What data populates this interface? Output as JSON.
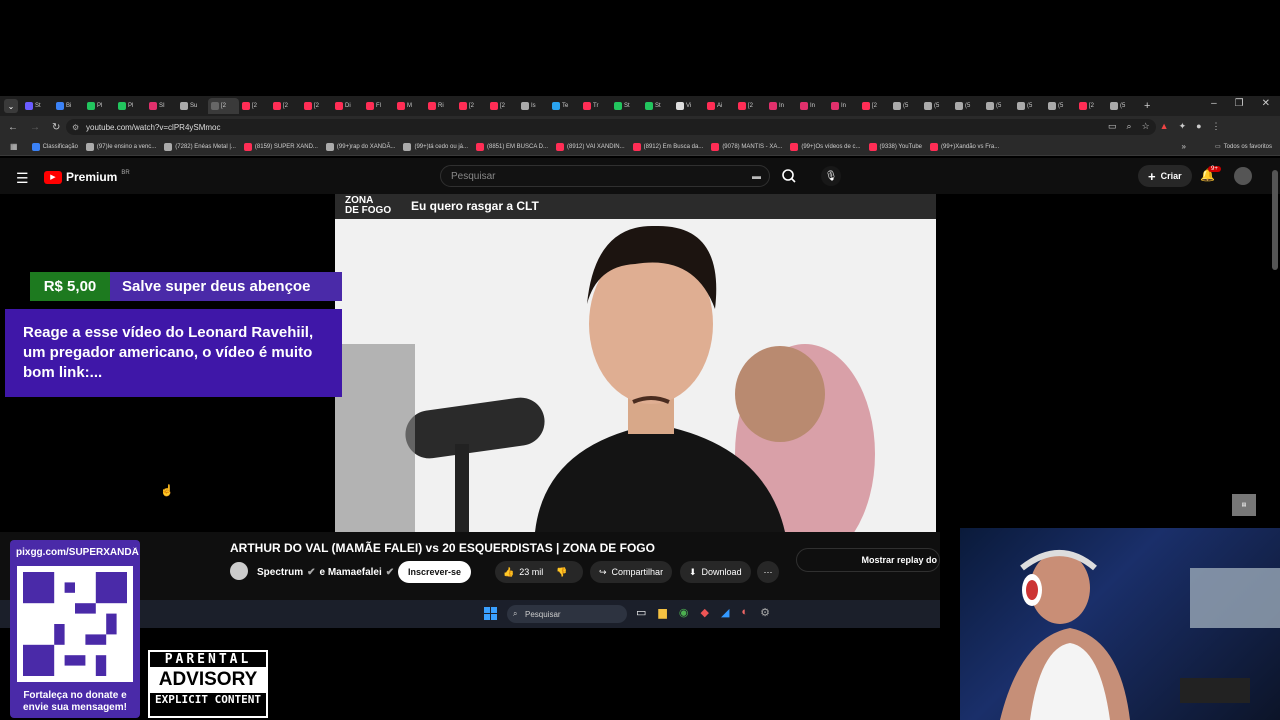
{
  "browser": {
    "url": "youtube.com/watch?v=clPR4ySMmoc",
    "bookmarks": [
      "Classificação",
      "(97)Ie ensino a venc...",
      "(7282) Enéas Metal |...",
      "(8159) SUPER XAND...",
      "(99+)rap do XANDÃ...",
      "(99+)tá cedo ou já...",
      "(8851) EM BUSCA D...",
      "(8912) VAI XANDIN...",
      "(8912) Em Busca da...",
      "(9078) MANTIS - XA...",
      "(99+)Os vídeos de c...",
      "(9338) YouTube",
      "(99+)Xandão vs Fra..."
    ],
    "all_bookmarks": "Todos os favoritos",
    "tab_labels": [
      "St",
      "Bi",
      "Pl",
      "Pl",
      "SI",
      "Su",
      "[2",
      "[2",
      "[2",
      "[2",
      "Di",
      "Fl",
      "M",
      "Ri",
      "[2",
      "[2",
      "Is",
      "Te",
      "Tr",
      "St",
      "St",
      "Vi",
      "Ai",
      "[2",
      "In",
      "In",
      "In",
      "[2",
      "(5",
      "(5",
      "(5",
      "(5",
      "(5",
      "(5",
      "[2",
      "(5"
    ]
  },
  "youtube": {
    "logo": "Premium",
    "logo_badge": "BR",
    "search_placeholder": "Pesquisar",
    "create_label": "Criar",
    "notifications_badge": "9+",
    "video_title": "ARTHUR DO VAL (MAMÃE FALEI) vs 20 ESQUERDISTAS | ZONA DE FOGO",
    "channel": "Spectrum",
    "channel_collab": "e Mamaefalei",
    "subscribe_label": "Inscrever-se",
    "likes": "23 mil",
    "share_label": "Compartilhar",
    "download_label": "Download",
    "chat_replay": "Mostrar replay do",
    "video_overlay_logo_top": "ZONA",
    "video_overlay_logo_bottom": "DE FOGO",
    "video_overlay_caption": "Eu quero rasgar a CLT"
  },
  "stream_overlay": {
    "donation_amount": "R$ 5,00",
    "donation_name": "Salve super deus abençoe",
    "donation_message": "Reage a esse vídeo do Leonard Ravehiil, um pregador americano, o vídeo é muito bom link:...",
    "qr_url": "pixgg.com/SUPERXANDÃ",
    "qr_caption_line1": "Fortaleça no donate e",
    "qr_caption_line2": "envie sua mensagem!",
    "advisory_top": "PARENTAL",
    "advisory_middle": "ADVISORY",
    "advisory_bottom": "EXPLICIT CONTENT"
  },
  "taskbar": {
    "search_placeholder": "Pesquisar"
  },
  "colors": {
    "donation_green": "#1d7a1f",
    "donation_purple": "#4a2aa8",
    "youtube_red": "#ff0000"
  }
}
